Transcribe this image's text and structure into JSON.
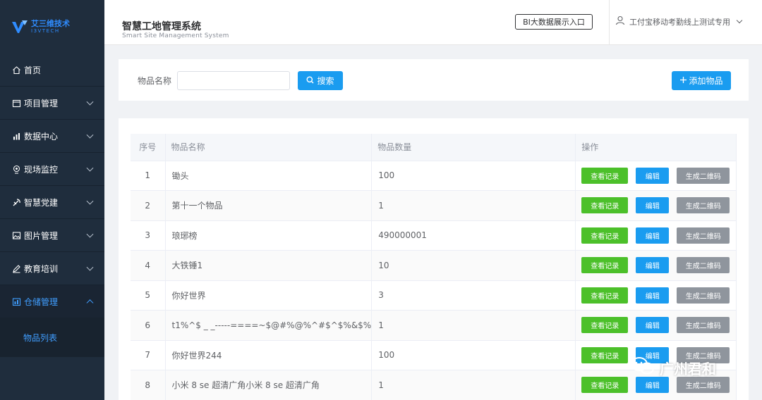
{
  "brand": {
    "name_cn": "艾三维技术",
    "name_en": "I3VTECH",
    "accent": "#2f8cff"
  },
  "sidebar": {
    "items": [
      {
        "label": "首页",
        "icon": "home-icon",
        "has_children": false
      },
      {
        "label": "项目管理",
        "icon": "calendar-icon",
        "has_children": true
      },
      {
        "label": "数据中心",
        "icon": "chart-icon",
        "has_children": true
      },
      {
        "label": "现场监控",
        "icon": "camera-icon",
        "has_children": true
      },
      {
        "label": "智慧党建",
        "icon": "party-icon",
        "has_children": true
      },
      {
        "label": "图片管理",
        "icon": "image-icon",
        "has_children": true
      },
      {
        "label": "教育培训",
        "icon": "pen-icon",
        "has_children": true
      },
      {
        "label": "仓储管理",
        "icon": "warehouse-icon",
        "has_children": true,
        "open": true
      }
    ],
    "submenu": {
      "label": "物品列表"
    }
  },
  "header": {
    "title": "智慧工地管理系统",
    "subtitle": "Smart Site Management System",
    "bi_button": "BI大数据展示入口",
    "user_name": "工付宝移动考勤线上测试专用"
  },
  "search": {
    "label": "物品名称",
    "input_value": "",
    "search_button": "搜索",
    "add_button": "添加物品"
  },
  "table": {
    "columns": [
      "序号",
      "物品名称",
      "物品数量",
      "操作"
    ],
    "rows": [
      {
        "no": "1",
        "name": "锄头",
        "qty": "100"
      },
      {
        "no": "2",
        "name": "第十一个物品",
        "qty": "1"
      },
      {
        "no": "3",
        "name": "琅琊榜",
        "qty": "490000001"
      },
      {
        "no": "4",
        "name": "大铁锤1",
        "qty": "10"
      },
      {
        "no": "5",
        "name": "你好世界",
        "qty": "3"
      },
      {
        "no": "6",
        "name": "t1%^$ _ _-----====~$@#%@%^#$^$%&$%",
        "qty": "1"
      },
      {
        "no": "7",
        "name": "你好世界244",
        "qty": "100"
      },
      {
        "no": "8",
        "name": "小米 8 se 超清广角小米 8 se 超清广角",
        "qty": "1"
      }
    ],
    "actions": {
      "view": "查看记录",
      "edit": "编辑",
      "qr": "生成二维码"
    }
  },
  "watermark": {
    "text": "广州君和"
  },
  "colors": {
    "sidebar_bg": "#1f2d3d",
    "primary": "#1a9cf0",
    "success": "#4cc02a",
    "gray_btn": "#8f959d",
    "active": "#409eff"
  }
}
